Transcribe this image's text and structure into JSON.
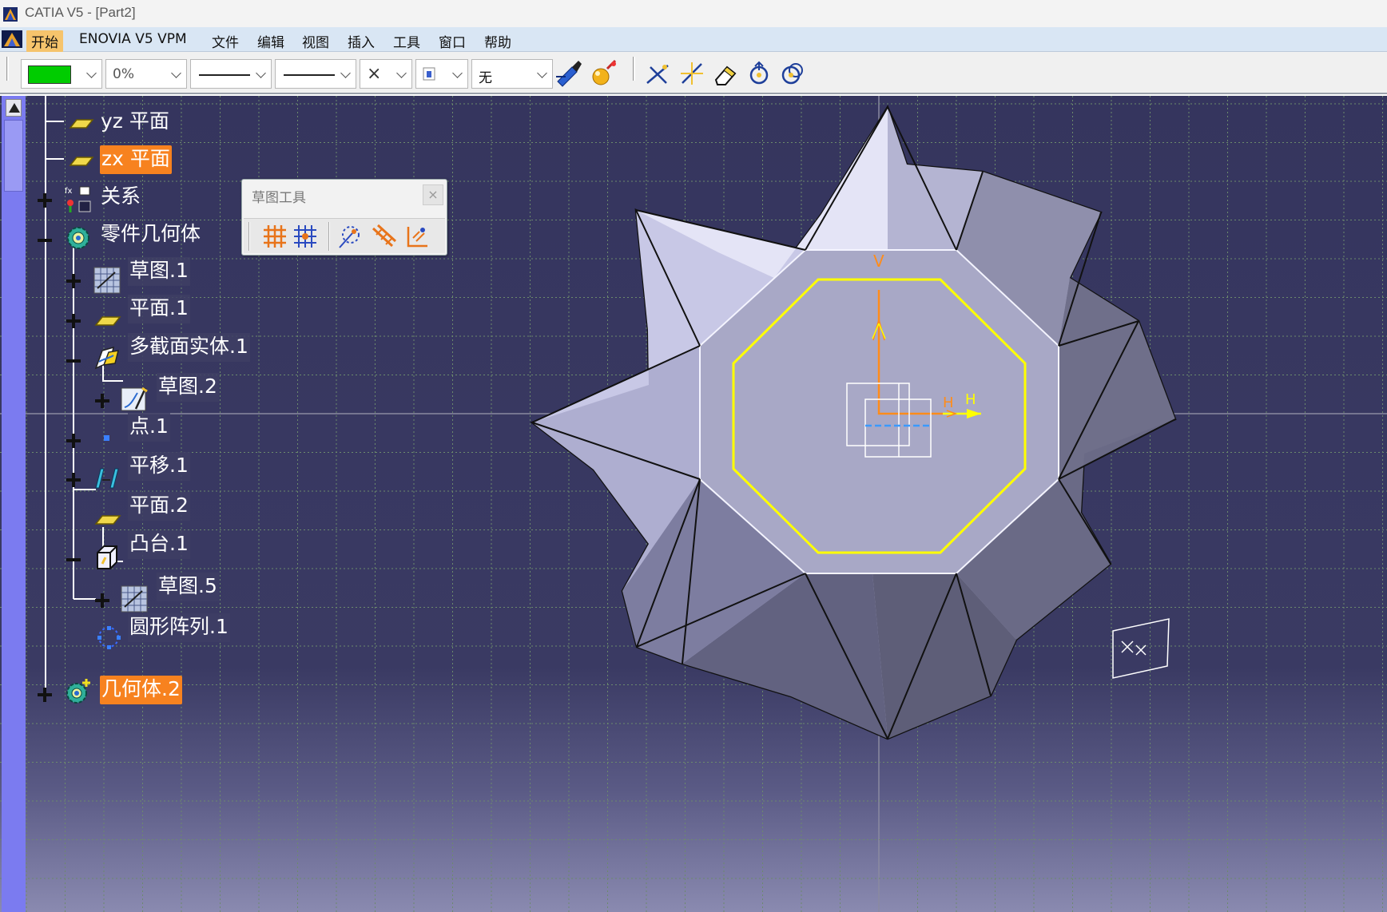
{
  "window": {
    "title": "CATIA V5 - [Part2]"
  },
  "menu": {
    "items": [
      {
        "id": "start",
        "label": "开始",
        "active": true
      },
      {
        "id": "enovia",
        "label": "ENOVIA V5 VPM"
      },
      {
        "id": "file",
        "label": "文件"
      },
      {
        "id": "edit",
        "label": "编辑"
      },
      {
        "id": "view",
        "label": "视图"
      },
      {
        "id": "insert",
        "label": "插入"
      },
      {
        "id": "tools",
        "label": "工具"
      },
      {
        "id": "window",
        "label": "窗口"
      },
      {
        "id": "help",
        "label": "帮助"
      }
    ]
  },
  "toolbar": {
    "color_value": "#00cc00",
    "transparency": "0%",
    "line_type": "solid",
    "line_weight": "solid",
    "point_symbol": "×",
    "layer": "无",
    "icons": [
      "painter-icon",
      "apply-material-icon",
      "cut-icon",
      "fastener-icon",
      "eraser-icon",
      "rotate-icon",
      "rotate-copy-icon"
    ]
  },
  "tree": {
    "items": [
      {
        "id": "yz-plane",
        "label": "yz 平面",
        "icon": "plane-icon"
      },
      {
        "id": "zx-plane",
        "label": "zx 平面",
        "icon": "plane-icon",
        "selected": true
      },
      {
        "id": "relations",
        "label": "关系",
        "icon": "relations-icon",
        "expander": "plus"
      },
      {
        "id": "part-body",
        "label": "零件几何体",
        "icon": "body-gear-icon",
        "expander": "minus"
      },
      {
        "id": "sketch-1",
        "label": "草图.1",
        "icon": "sketch-icon",
        "expander": "plus"
      },
      {
        "id": "plane-1",
        "label": "平面.1",
        "icon": "plane-icon",
        "expander": "plus"
      },
      {
        "id": "msolid-1",
        "label": "多截面实体.1",
        "icon": "multisection-icon",
        "expander": "minus"
      },
      {
        "id": "sketch-2",
        "label": "草图.2",
        "icon": "sketch-edit-icon",
        "expander": "plus"
      },
      {
        "id": "point-1",
        "label": "点.1",
        "icon": "point-icon",
        "expander": "plus"
      },
      {
        "id": "translate-1",
        "label": "平移.1",
        "icon": "translate-icon",
        "expander": "plus"
      },
      {
        "id": "plane-2",
        "label": "平面.2",
        "icon": "plane-icon"
      },
      {
        "id": "pad-1",
        "label": "凸台.1",
        "icon": "pad-icon",
        "expander": "minus"
      },
      {
        "id": "sketch-5",
        "label": "草图.5",
        "icon": "sketch-icon",
        "expander": "plus"
      },
      {
        "id": "circpattern-1",
        "label": "圆形阵列.1",
        "icon": "circular-pattern-icon"
      },
      {
        "id": "body-2",
        "label": "几何体.2",
        "icon": "body-gear-icon",
        "expander": "plus",
        "selected": true
      }
    ]
  },
  "palette": {
    "title": "草图工具",
    "close": "×",
    "icons": [
      "grid-icon",
      "snap-to-point-icon",
      "construction-element-icon",
      "geometrical-constraints-icon",
      "dimensional-constraints-icon"
    ]
  },
  "viewport": {
    "axis_labels": {
      "v": "V",
      "h1": "H",
      "h2": "H"
    },
    "colors": {
      "profile": "#ffff00",
      "axis": "#ff8c1a",
      "edge": "#111111"
    }
  }
}
